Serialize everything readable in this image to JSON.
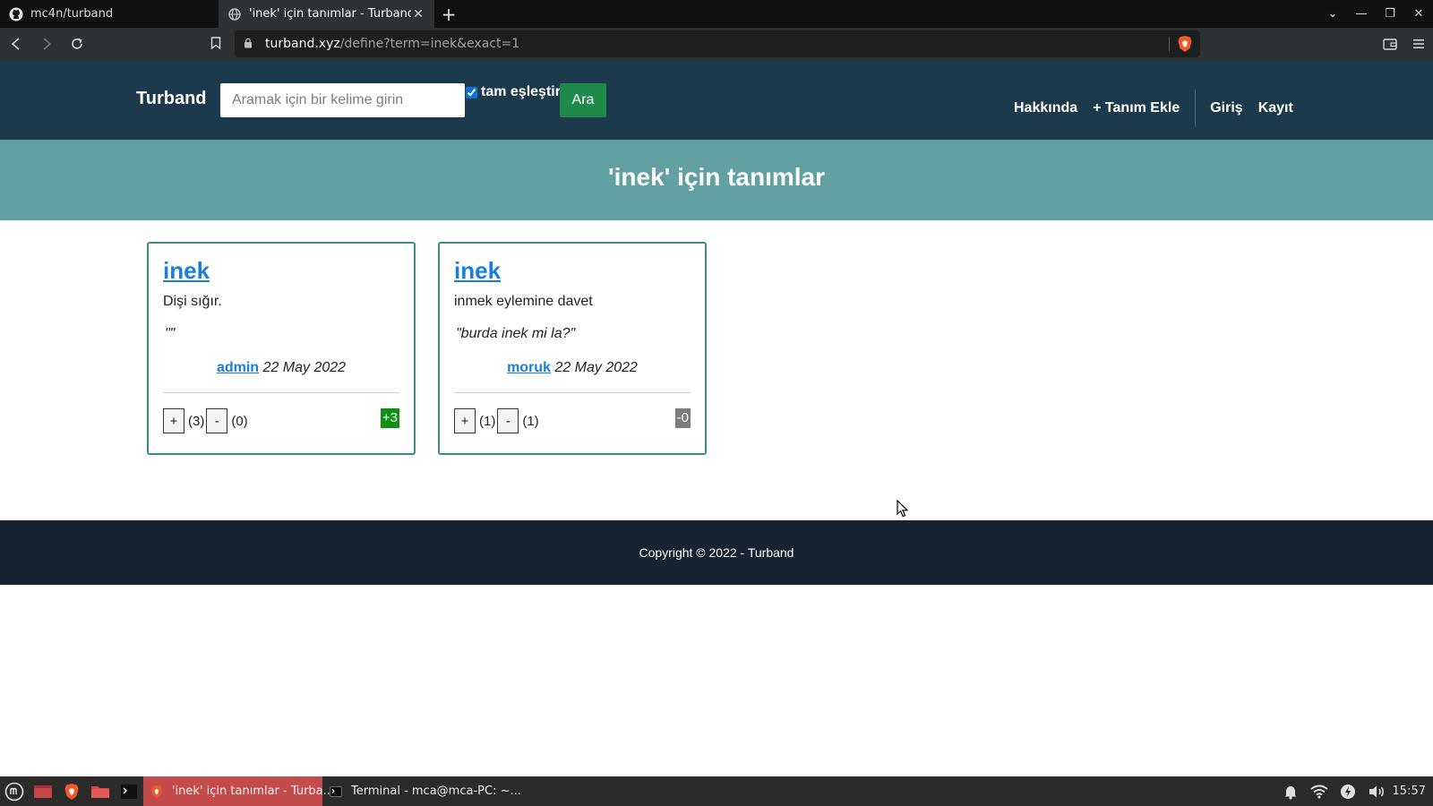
{
  "browser": {
    "tabs": [
      {
        "title": "mc4n/turband",
        "icon": "github-icon",
        "active": false
      },
      {
        "title": "'inek' için tanımlar - Turband",
        "icon": "globe-icon",
        "active": true
      }
    ],
    "url_host": "turband.xyz",
    "url_path": "/define?term=inek&exact=1"
  },
  "site": {
    "brand": "Turband",
    "search": {
      "placeholder": "Aramak için bir kelime girin",
      "exact_label": "tam eşleştir",
      "exact_checked": true,
      "button_label": "Ara"
    },
    "nav": {
      "about": "Hakkında",
      "add_definition": "+ Tanım Ekle",
      "login": "Giriş",
      "register": "Kayıt"
    },
    "hero_title": "'inek' için tanımlar",
    "definitions": [
      {
        "word": "inek",
        "definition": "Dişi sığır.",
        "example": "\"\"",
        "author": "admin",
        "date": "22 May 2022",
        "up_label": "+",
        "up_count": "(3)",
        "down_label": "-",
        "down_count": "(0)",
        "score": "+3"
      },
      {
        "word": "inek",
        "definition": "inmek eylemine davet",
        "example": "\"burda inek mi la?\"",
        "author": "moruk",
        "date": "22 May 2022",
        "up_label": "+",
        "up_count": "(1)",
        "down_label": "-",
        "down_count": "(1)",
        "score": "-0"
      }
    ],
    "footer": "Copyright © 2022 - Turband"
  },
  "taskbar": {
    "apps": [
      {
        "label": "'inek' için tanımlar - Turba...",
        "active": true
      },
      {
        "label": "Terminal - mca@mca-PC: ~...",
        "active": false
      }
    ],
    "clock": "15:57"
  },
  "colors": {
    "navbar": "#1d3a4d",
    "hero": "#62a0a4",
    "search_button": "#1f8a4c",
    "link": "#1a7ee0",
    "score_positive": "#0f8f16",
    "score_zero": "#7c7c7c",
    "footer": "#162431"
  }
}
